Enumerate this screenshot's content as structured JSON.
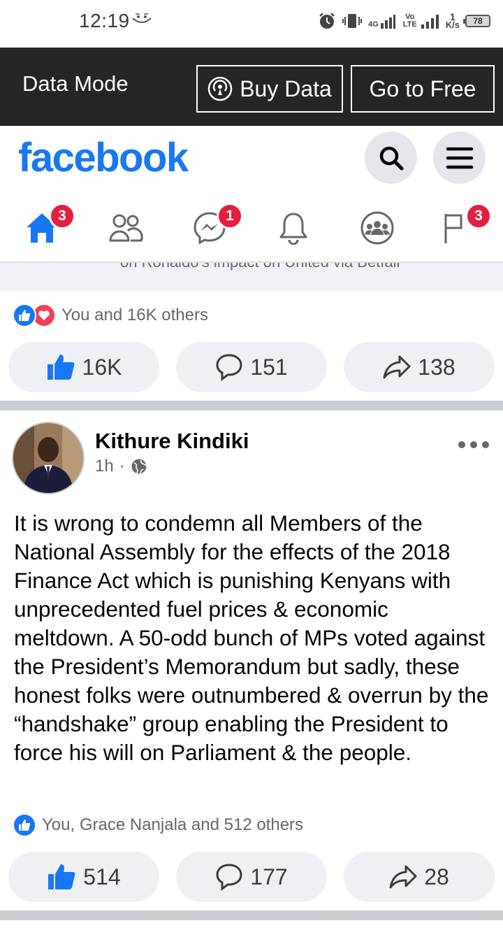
{
  "status_bar": {
    "time": "12:19",
    "network_4g": "4G",
    "volte": "Vo LTE",
    "speed_value": "1",
    "speed_unit": "K/s",
    "battery": "78"
  },
  "data_bar": {
    "label": "Data Mode",
    "buy_data_label": "Buy Data",
    "go_free_label": "Go to Free"
  },
  "header": {
    "logo": "facebook",
    "nav": {
      "home_badge": "3",
      "messenger_badge": "1",
      "pages_badge": "3"
    }
  },
  "previous_post": {
    "caption": "on Ronaldo's impact on United via Betfair",
    "reactions_text": "You and 16K others",
    "like_count": "16K",
    "comment_count": "151",
    "share_count": "138"
  },
  "post": {
    "author": "Kithure Kindiki",
    "time": "1h",
    "separator": "·",
    "text": "It is wrong to condemn all Members of the National Assembly for the effects of the 2018 Finance Act which is punishing Kenyans with unprecedented fuel prices & economic meltdown. A 50-odd bunch of MPs voted against the President’s Memorandum but sadly, these honest folks were outnumbered & overrun by the “handshake” group enabling the President to force his will on Parliament & the people.",
    "reactions_text": "You, Grace Nanjala and 512 others",
    "like_count": "514",
    "comment_count": "177",
    "share_count": "28"
  },
  "colors": {
    "brand": "#1877f2",
    "badge": "#e41e3f",
    "data_bar": "#242526"
  }
}
